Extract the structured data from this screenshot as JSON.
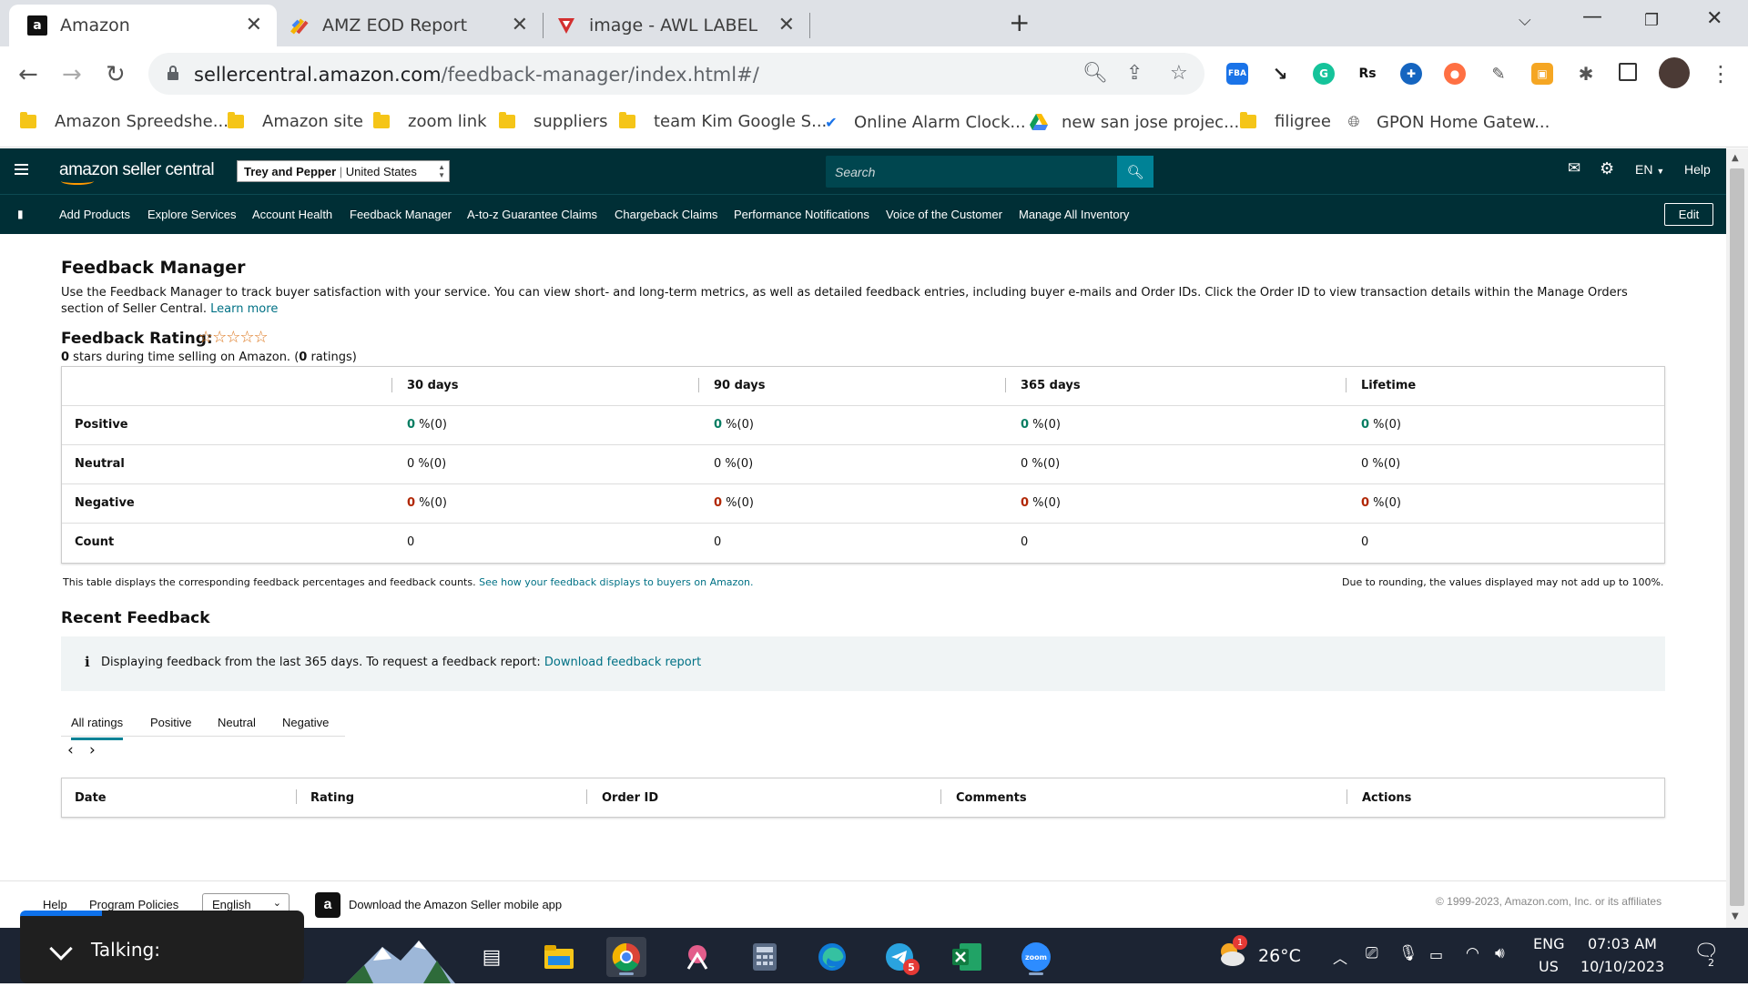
{
  "browser": {
    "tabs": [
      {
        "title": "Amazon",
        "favicon": "amazon-a",
        "active": true
      },
      {
        "title": "AMZ EOD Report",
        "favicon": "multicolor-pen",
        "active": false
      },
      {
        "title": "image - AWL LABEL",
        "favicon": "red-v-logo",
        "active": false
      }
    ],
    "new_tab_label": "+",
    "url_domain": "sellercentral.amazon.com",
    "url_path": "/feedback-manager/index.html#/",
    "bookmarks": [
      {
        "label": "Amazon Spreedshe...",
        "icon": "folder"
      },
      {
        "label": "Amazon site",
        "icon": "folder"
      },
      {
        "label": "zoom link",
        "icon": "folder"
      },
      {
        "label": "suppliers",
        "icon": "folder"
      },
      {
        "label": "team Kim Google S...",
        "icon": "folder"
      },
      {
        "label": "Online Alarm Clock...",
        "icon": "check-clock"
      },
      {
        "label": "new san jose projec...",
        "icon": "google-drive"
      },
      {
        "label": "filigree",
        "icon": "folder"
      },
      {
        "label": "GPON Home Gatew...",
        "icon": "globe"
      }
    ],
    "extensions": [
      "FBA",
      "Rs"
    ]
  },
  "seller_header": {
    "logo": "amazon seller central",
    "store_name": "Trey and Pepper",
    "store_region": "United States",
    "search_placeholder": "Search",
    "language": "EN",
    "help": "Help"
  },
  "nav": {
    "items": [
      "Add Products",
      "Explore Services",
      "Account Health",
      "Feedback Manager",
      "A-to-z Guarantee Claims",
      "Chargeback Claims",
      "Performance Notifications",
      "Voice of the Customer",
      "Manage All Inventory"
    ],
    "edit": "Edit"
  },
  "page": {
    "title": "Feedback Manager",
    "intro": "Use the Feedback Manager to track buyer satisfaction with your service. You can view short- and long-term metrics, as well as detailed feedback entries, including buyer e-mails and Order IDs. Click the Order ID to view transaction details within the Manage Orders section of Seller Central.",
    "learn_more": "Learn more",
    "rating_label": "Feedback Rating:",
    "stars": "☆☆☆☆☆",
    "stars_count": "0",
    "stars_text": " stars during time selling on Amazon. (",
    "ratings_count": "0",
    "ratings_text": " ratings)"
  },
  "feedback_table": {
    "columns": [
      "30 days",
      "90 days",
      "365 days",
      "Lifetime"
    ],
    "rows": [
      {
        "label": "Positive",
        "values": [
          "0",
          "0",
          "0",
          "0"
        ],
        "suffix": " %(0)",
        "color": "#067d62"
      },
      {
        "label": "Neutral",
        "values": [
          "0",
          "0",
          "0",
          "0"
        ],
        "suffix": " %(0)",
        "color": "#111111"
      },
      {
        "label": "Negative",
        "values": [
          "0",
          "0",
          "0",
          "0"
        ],
        "suffix": " %(0)",
        "color": "#b12704"
      },
      {
        "label": "Count",
        "values": [
          "0",
          "0",
          "0",
          "0"
        ],
        "suffix": "",
        "color": "#111111"
      }
    ],
    "note_left": "This table displays the corresponding feedback percentages and feedback counts.",
    "note_link": "See how your feedback displays to buyers on Amazon.",
    "note_right": "Due to rounding, the values displayed may not add up to 100%."
  },
  "recent": {
    "title": "Recent Feedback",
    "info_icon": "i",
    "info_text": "Displaying feedback from the last 365 days. To request a feedback report:",
    "info_link": "Download feedback report",
    "tabs": [
      "All ratings",
      "Positive",
      "Neutral",
      "Negative"
    ],
    "selected_tab": "All ratings",
    "prev": "‹",
    "next": "›",
    "columns": [
      "Date",
      "Rating",
      "Order ID",
      "Comments",
      "Actions"
    ]
  },
  "footer": {
    "help": "Help",
    "policies": "Program Policies",
    "language": "English",
    "mobile": "Download the Amazon Seller mobile app",
    "copyright": "© 1999-2023, Amazon.com, Inc. or its affiliates"
  },
  "overlay": {
    "talking": "Talking:"
  },
  "taskbar": {
    "weather": "26°C",
    "weather_badge": "1",
    "telegram_badge": "5",
    "lang1": "ENG",
    "lang2": "US",
    "time": "07:03 AM",
    "date": "10/10/2023",
    "notif_count": "2"
  }
}
